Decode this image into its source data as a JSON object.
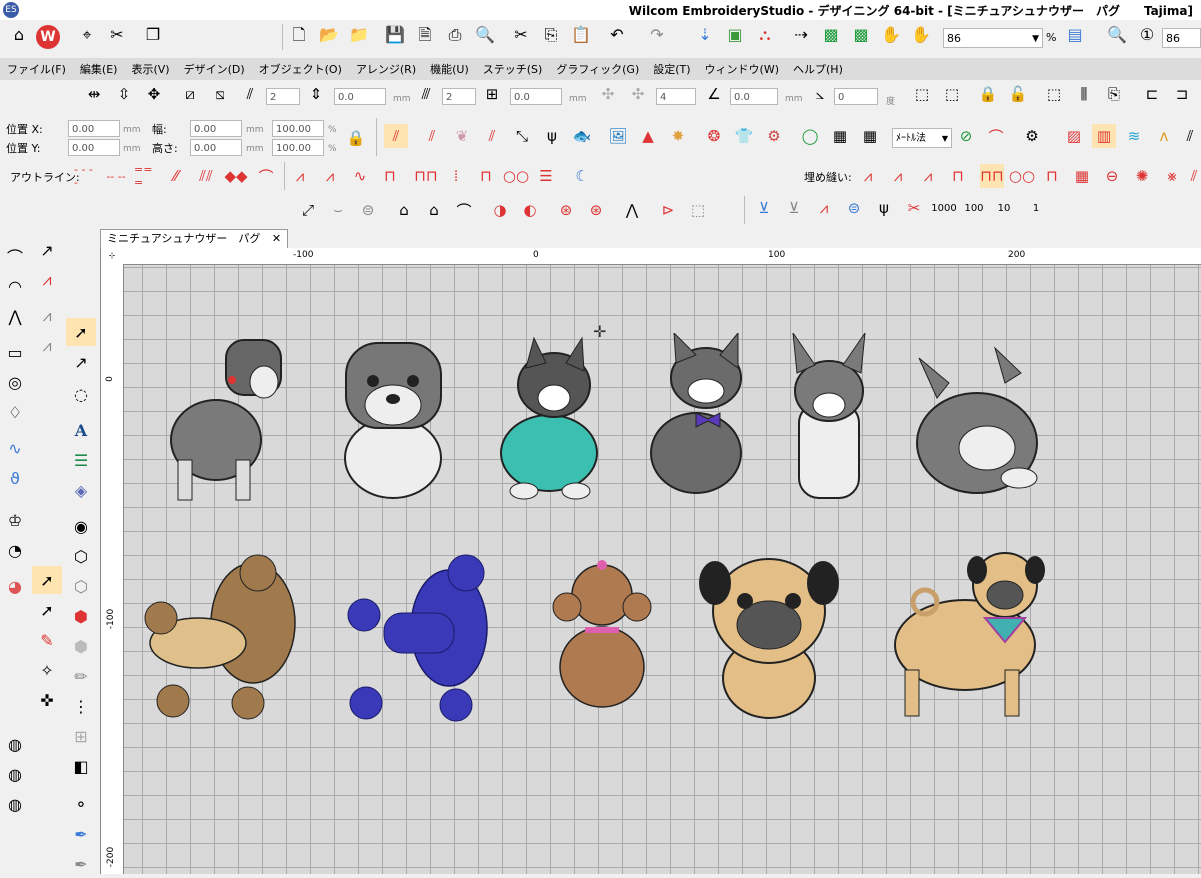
{
  "window": {
    "app_icon_text": "ES",
    "title": "Wilcom EmbroideryStudio - デザイニング 64-bit - [ミニチュアシュナウザー　パグ　　Tajima]"
  },
  "toolbar": {
    "zoom_value": "86",
    "zoom_unit": "%",
    "stitch_value": "86"
  },
  "menu": {
    "items": [
      "ファイル(F)",
      "編集(E)",
      "表示(V)",
      "デザイン(D)",
      "オブジェクト(O)",
      "アレンジ(R)",
      "機能(U)",
      "ステッチ(S)",
      "グラフィック(G)",
      "設定(T)",
      "ウィンドウ(W)",
      "ヘルプ(H)"
    ]
  },
  "transform": {
    "spin1": "2",
    "spin2": "0.0",
    "spin2_unit": "mm",
    "spin3": "2",
    "spin4": "0.0",
    "spin4_unit": "mm",
    "spin5": "4",
    "spin6": "0.0",
    "spin6_unit": "mm",
    "spin7": "0",
    "spin7_unit": "度"
  },
  "position": {
    "x_label": "位置 X:",
    "y_label": "位置 Y:",
    "x_value": "0.00",
    "y_value": "0.00",
    "width_label": "幅:",
    "height_label": "高さ:",
    "width_value": "0.00",
    "height_value": "0.00",
    "width_pct": "100.00",
    "height_pct": "100.00",
    "unit_mm": "mm",
    "unit_pct": "%"
  },
  "props": {
    "unit_select": "ﾒｰﾄﾙ法"
  },
  "outline_bar": {
    "label": "アウトライン:",
    "fill_label": "埋め縫い:"
  },
  "stitch_counts": [
    "1000",
    "100",
    "10",
    "1"
  ],
  "document_tab": {
    "title": "ミニチュアシュナウザー　パグ",
    "close": "✕"
  },
  "ruler": {
    "h_labels": [
      "-100",
      "0",
      "100",
      "200"
    ],
    "v_labels": [
      "0",
      "-100",
      "-200"
    ]
  },
  "designs": [
    {
      "name": "schnauzer-standing",
      "color": "#6f6f6f"
    },
    {
      "name": "schnauzer-sitting",
      "color": "#6f6f6f"
    },
    {
      "name": "boston-terrier-sweater",
      "color": "#2fb5a8"
    },
    {
      "name": "boston-terrier-bowtie",
      "color": "#6b6b6b"
    },
    {
      "name": "boston-terrier-front",
      "color": "#7a7a7a"
    },
    {
      "name": "boston-terrier-lying",
      "color": "#7a7a7a"
    },
    {
      "name": "poodle-brown",
      "color": "#a07a4c"
    },
    {
      "name": "poodle-blue",
      "color": "#3a3aa8"
    },
    {
      "name": "toy-poodle",
      "color": "#b07a50"
    },
    {
      "name": "pug-front",
      "color": "#e3be86"
    },
    {
      "name": "pug-standing",
      "color": "#e3be86"
    }
  ]
}
